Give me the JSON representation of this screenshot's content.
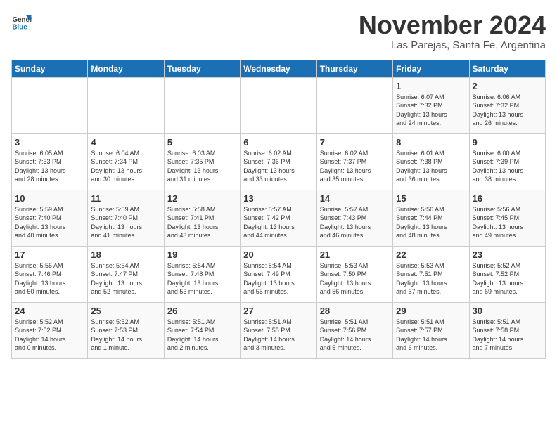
{
  "logo": {
    "line1": "General",
    "line2": "Blue"
  },
  "title": "November 2024",
  "subtitle": "Las Parejas, Santa Fe, Argentina",
  "days_of_week": [
    "Sunday",
    "Monday",
    "Tuesday",
    "Wednesday",
    "Thursday",
    "Friday",
    "Saturday"
  ],
  "weeks": [
    [
      {
        "day": "",
        "info": ""
      },
      {
        "day": "",
        "info": ""
      },
      {
        "day": "",
        "info": ""
      },
      {
        "day": "",
        "info": ""
      },
      {
        "day": "",
        "info": ""
      },
      {
        "day": "1",
        "info": "Sunrise: 6:07 AM\nSunset: 7:32 PM\nDaylight: 13 hours\nand 24 minutes."
      },
      {
        "day": "2",
        "info": "Sunrise: 6:06 AM\nSunset: 7:32 PM\nDaylight: 13 hours\nand 26 minutes."
      }
    ],
    [
      {
        "day": "3",
        "info": "Sunrise: 6:05 AM\nSunset: 7:33 PM\nDaylight: 13 hours\nand 28 minutes."
      },
      {
        "day": "4",
        "info": "Sunrise: 6:04 AM\nSunset: 7:34 PM\nDaylight: 13 hours\nand 30 minutes."
      },
      {
        "day": "5",
        "info": "Sunrise: 6:03 AM\nSunset: 7:35 PM\nDaylight: 13 hours\nand 31 minutes."
      },
      {
        "day": "6",
        "info": "Sunrise: 6:02 AM\nSunset: 7:36 PM\nDaylight: 13 hours\nand 33 minutes."
      },
      {
        "day": "7",
        "info": "Sunrise: 6:02 AM\nSunset: 7:37 PM\nDaylight: 13 hours\nand 35 minutes."
      },
      {
        "day": "8",
        "info": "Sunrise: 6:01 AM\nSunset: 7:38 PM\nDaylight: 13 hours\nand 36 minutes."
      },
      {
        "day": "9",
        "info": "Sunrise: 6:00 AM\nSunset: 7:39 PM\nDaylight: 13 hours\nand 38 minutes."
      }
    ],
    [
      {
        "day": "10",
        "info": "Sunrise: 5:59 AM\nSunset: 7:40 PM\nDaylight: 13 hours\nand 40 minutes."
      },
      {
        "day": "11",
        "info": "Sunrise: 5:59 AM\nSunset: 7:40 PM\nDaylight: 13 hours\nand 41 minutes."
      },
      {
        "day": "12",
        "info": "Sunrise: 5:58 AM\nSunset: 7:41 PM\nDaylight: 13 hours\nand 43 minutes."
      },
      {
        "day": "13",
        "info": "Sunrise: 5:57 AM\nSunset: 7:42 PM\nDaylight: 13 hours\nand 44 minutes."
      },
      {
        "day": "14",
        "info": "Sunrise: 5:57 AM\nSunset: 7:43 PM\nDaylight: 13 hours\nand 46 minutes."
      },
      {
        "day": "15",
        "info": "Sunrise: 5:56 AM\nSunset: 7:44 PM\nDaylight: 13 hours\nand 48 minutes."
      },
      {
        "day": "16",
        "info": "Sunrise: 5:56 AM\nSunset: 7:45 PM\nDaylight: 13 hours\nand 49 minutes."
      }
    ],
    [
      {
        "day": "17",
        "info": "Sunrise: 5:55 AM\nSunset: 7:46 PM\nDaylight: 13 hours\nand 50 minutes."
      },
      {
        "day": "18",
        "info": "Sunrise: 5:54 AM\nSunset: 7:47 PM\nDaylight: 13 hours\nand 52 minutes."
      },
      {
        "day": "19",
        "info": "Sunrise: 5:54 AM\nSunset: 7:48 PM\nDaylight: 13 hours\nand 53 minutes."
      },
      {
        "day": "20",
        "info": "Sunrise: 5:54 AM\nSunset: 7:49 PM\nDaylight: 13 hours\nand 55 minutes."
      },
      {
        "day": "21",
        "info": "Sunrise: 5:53 AM\nSunset: 7:50 PM\nDaylight: 13 hours\nand 56 minutes."
      },
      {
        "day": "22",
        "info": "Sunrise: 5:53 AM\nSunset: 7:51 PM\nDaylight: 13 hours\nand 57 minutes."
      },
      {
        "day": "23",
        "info": "Sunrise: 5:52 AM\nSunset: 7:52 PM\nDaylight: 13 hours\nand 59 minutes."
      }
    ],
    [
      {
        "day": "24",
        "info": "Sunrise: 5:52 AM\nSunset: 7:52 PM\nDaylight: 14 hours\nand 0 minutes."
      },
      {
        "day": "25",
        "info": "Sunrise: 5:52 AM\nSunset: 7:53 PM\nDaylight: 14 hours\nand 1 minute."
      },
      {
        "day": "26",
        "info": "Sunrise: 5:51 AM\nSunset: 7:54 PM\nDaylight: 14 hours\nand 2 minutes."
      },
      {
        "day": "27",
        "info": "Sunrise: 5:51 AM\nSunset: 7:55 PM\nDaylight: 14 hours\nand 3 minutes."
      },
      {
        "day": "28",
        "info": "Sunrise: 5:51 AM\nSunset: 7:56 PM\nDaylight: 14 hours\nand 5 minutes."
      },
      {
        "day": "29",
        "info": "Sunrise: 5:51 AM\nSunset: 7:57 PM\nDaylight: 14 hours\nand 6 minutes."
      },
      {
        "day": "30",
        "info": "Sunrise: 5:51 AM\nSunset: 7:58 PM\nDaylight: 14 hours\nand 7 minutes."
      }
    ]
  ]
}
